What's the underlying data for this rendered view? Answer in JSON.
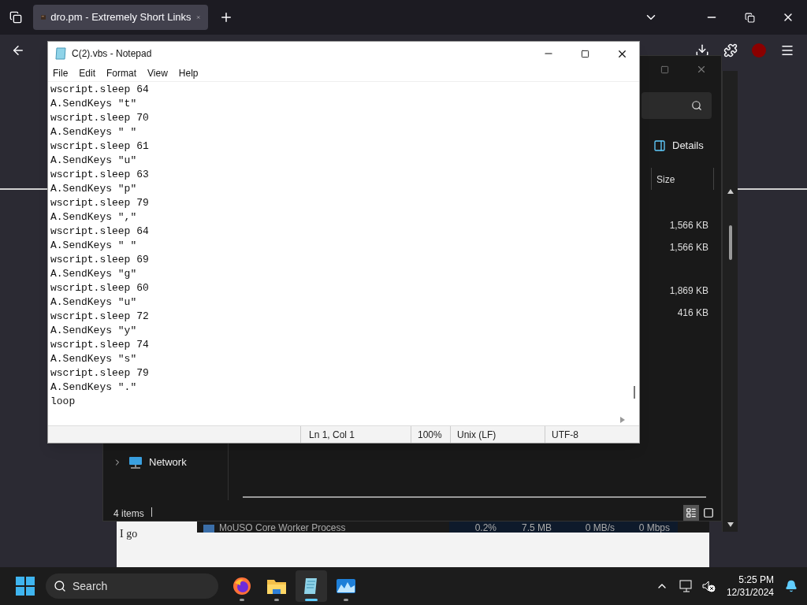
{
  "browser": {
    "tab_title": "dro.pm - Extremely Short Links"
  },
  "background": {
    "document_text": "I go",
    "process_row": {
      "name": "MoUSO Core Worker Process",
      "cpu": "0.2%",
      "memory": "7.5 MB",
      "disk": "0 MB/s",
      "network": "0 Mbps"
    }
  },
  "explorer": {
    "view_label": "Details",
    "column": "Size",
    "sizes": [
      "1,566 KB",
      "1,566 KB",
      "1,869 KB",
      "416 KB"
    ],
    "nav_item": "Network",
    "status": "4 items"
  },
  "notepad": {
    "title": "C(2).vbs - Notepad",
    "menu": [
      "File",
      "Edit",
      "Format",
      "View",
      "Help"
    ],
    "lines": [
      "wscript.sleep 64",
      "A.SendKeys \"t\"",
      "wscript.sleep 70",
      "A.SendKeys \" \"",
      "wscript.sleep 61",
      "A.SendKeys \"u\"",
      "wscript.sleep 63",
      "A.SendKeys \"p\"",
      "wscript.sleep 79",
      "A.SendKeys \",\"",
      "wscript.sleep 64",
      "A.SendKeys \" \"",
      "wscript.sleep 69",
      "A.SendKeys \"g\"",
      "wscript.sleep 60",
      "A.SendKeys \"u\"",
      "wscript.sleep 72",
      "A.SendKeys \"y\"",
      "wscript.sleep 74",
      "A.SendKeys \"s\"",
      "wscript.sleep 79",
      "A.SendKeys \".\"",
      "loop"
    ],
    "status": {
      "position": "Ln 1, Col 1",
      "zoom": "100%",
      "line_ending": "Unix (LF)",
      "encoding": "UTF-8"
    }
  },
  "taskbar": {
    "search_placeholder": "Search",
    "apps": [
      {
        "kind": "firefox",
        "selected": false
      },
      {
        "kind": "folder",
        "selected": false
      },
      {
        "kind": "notepad",
        "selected": true
      },
      {
        "kind": "monitor",
        "selected": false
      }
    ],
    "time": "5:25 PM",
    "date": "12/31/2024"
  }
}
